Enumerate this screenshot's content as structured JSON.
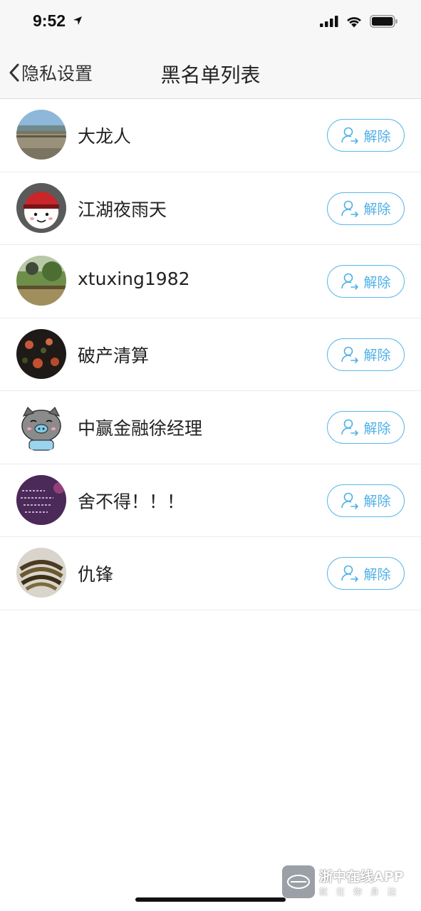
{
  "status": {
    "time": "9:52"
  },
  "nav": {
    "back_label": "隐私设置",
    "title": "黑名单列表"
  },
  "list": {
    "items": [
      {
        "name": "大龙人",
        "action": "解除"
      },
      {
        "name": "江湖夜雨天",
        "action": "解除"
      },
      {
        "name": "xtuxing1982",
        "action": "解除"
      },
      {
        "name": "破产清算",
        "action": "解除"
      },
      {
        "name": "中赢金融徐经理",
        "action": "解除"
      },
      {
        "name": "舍不得！！！",
        "action": "解除"
      },
      {
        "name": "仇锋",
        "action": "解除"
      }
    ]
  },
  "watermark": {
    "title": "浙中在线APP",
    "subtitle": "就在你身边"
  },
  "colors": {
    "accent": "#4fb0e6",
    "nav_bg": "#f7f7f7",
    "divider": "#ececec"
  }
}
